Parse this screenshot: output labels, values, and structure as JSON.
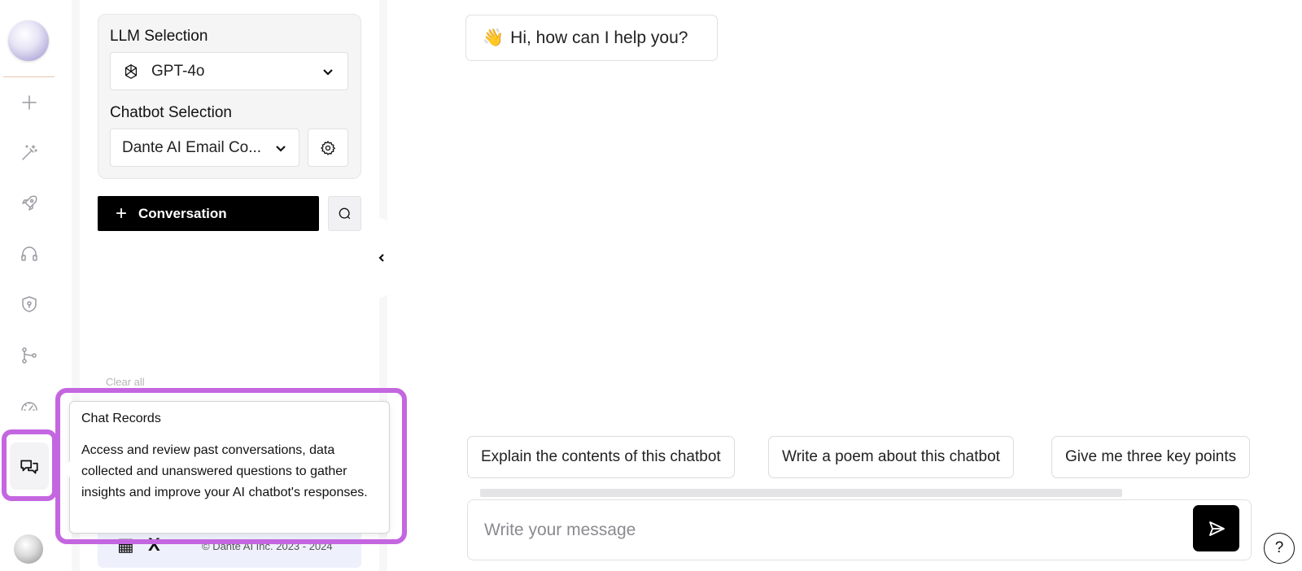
{
  "sidebar": {
    "icons": [
      "add-icon",
      "magic-wand-icon",
      "rocket-icon",
      "headset-icon",
      "shield-icon",
      "git-branch-icon",
      "gauge-icon",
      "chat-bubbles-icon"
    ]
  },
  "panel": {
    "llm_label": "LLM Selection",
    "llm_value": "GPT-4o",
    "chatbot_label": "Chatbot Selection",
    "chatbot_value": "Dante AI Email Co...",
    "new_conversation_label": "Conversation",
    "clear_all": "Clear all",
    "copyright": "© Dante AI Inc. 2023 - 2024"
  },
  "tooltip": {
    "title": "Chat Records",
    "body": "Access and review past conversations, data collected and unanswered questions to gather insights and improve your AI chatbot's responses."
  },
  "chat": {
    "greeting_emoji": "👋",
    "greeting": "Hi, how can I help you?",
    "suggestions": [
      "Explain the contents of this chatbot",
      "Write a poem about this chatbot",
      "Give me three key points"
    ],
    "input_placeholder": "Write your message"
  },
  "help_label": "?",
  "colors": {
    "highlight": "#c466e0",
    "primary": "#000000"
  }
}
